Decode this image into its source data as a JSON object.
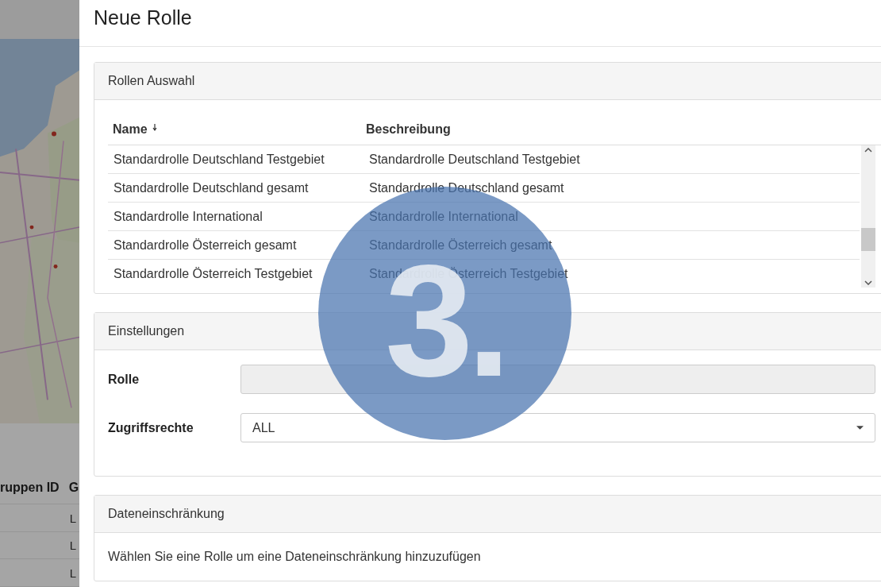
{
  "background_page": {
    "table_header": [
      "ruppen ID",
      "G"
    ],
    "rows": [
      "L",
      "L",
      "L"
    ]
  },
  "dialog": {
    "title": "Neue Rolle",
    "role_selection": {
      "title": "Rollen Auswahl",
      "columns": [
        {
          "label": "Name",
          "sorted": true
        },
        {
          "label": "Beschreibung",
          "sorted": false
        }
      ],
      "rows": [
        {
          "name": "Standardrolle Deutschland Testgebiet",
          "description": "Standardrolle Deutschland Testgebiet"
        },
        {
          "name": "Standardrolle Deutschland gesamt",
          "description": "Standardrolle Deutschland gesamt"
        },
        {
          "name": "Standardrolle International",
          "description": "Standardrolle International"
        },
        {
          "name": "Standardrolle Österreich gesamt",
          "description": "Standardrolle Österreich gesamt"
        },
        {
          "name": "Standardrolle Österreich Testgebiet",
          "description": "Standardrolle Österreich Testgebiet"
        }
      ]
    },
    "settings": {
      "title": "Einstellungen",
      "fields": [
        {
          "label": "Rolle",
          "kind": "text",
          "disabled": true
        },
        {
          "label": "Zugriffsrechte",
          "kind": "select",
          "value": "ALL",
          "disabled": false
        }
      ]
    },
    "data_restriction": {
      "title": "Dateneinschränkung",
      "message": "Wählen Sie eine Rolle um eine Dateneinschränkung hinzuzufügen"
    }
  },
  "step_marker": "3."
}
